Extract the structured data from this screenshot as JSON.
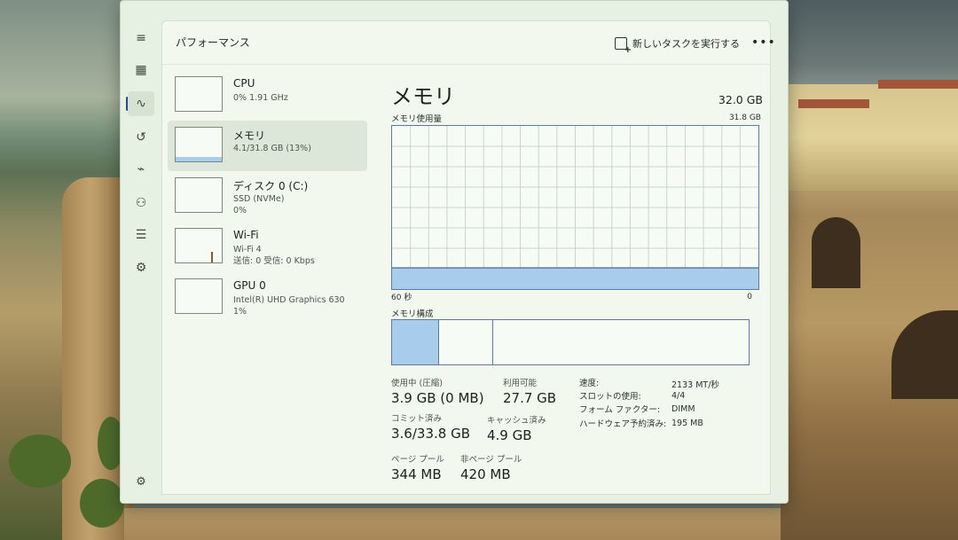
{
  "app": {
    "title": "パフォーマンス",
    "run_task_label": "新しいタスクを実行する",
    "more_label": "•••"
  },
  "nav": {
    "menu_icon": "≡",
    "items": [
      {
        "name": "processes",
        "icon": "▦"
      },
      {
        "name": "performance",
        "icon": "∿",
        "active": true
      },
      {
        "name": "app-history",
        "icon": "↺"
      },
      {
        "name": "startup",
        "icon": "⌁"
      },
      {
        "name": "users",
        "icon": "⚇"
      },
      {
        "name": "details",
        "icon": "☰"
      },
      {
        "name": "services",
        "icon": "⚙"
      }
    ],
    "settings_icon": "⚙"
  },
  "resources": [
    {
      "name": "CPU",
      "sub1": "0% 1.91 GHz",
      "sub2": "",
      "fill": 0.0
    },
    {
      "name": "メモリ",
      "sub1": "4.1/31.8 GB (13%)",
      "sub2": "",
      "fill": 0.13,
      "selected": true
    },
    {
      "name": "ディスク 0 (C:)",
      "sub1": "SSD (NVMe)",
      "sub2": "0%",
      "fill": 0.0
    },
    {
      "name": "Wi-Fi",
      "sub1": "Wi-Fi 4",
      "sub2": "送信: 0 受信: 0 Kbps",
      "fill": 0.0
    },
    {
      "name": "GPU 0",
      "sub1": "Intel(R) UHD Graphics 630",
      "sub2": "1%",
      "fill": 0.0
    }
  ],
  "detail": {
    "title": "メモリ",
    "total": "32.0 GB",
    "usage_label": "メモリ使用量",
    "usage_max": "31.8 GB",
    "axis_left": "60 秒",
    "axis_right": "0",
    "usage_fraction": 0.13,
    "composition_label": "メモリ構成",
    "composition_fractions": [
      0.13,
      0.15,
      0.72
    ],
    "stats": {
      "in_use_label": "使用中 (圧縮)",
      "in_use_value": "3.9 GB (0 MB)",
      "available_label": "利用可能",
      "available_value": "27.7 GB",
      "committed_label": "コミット済み",
      "committed_value": "3.6/33.8 GB",
      "cached_label": "キャッシュ済み",
      "cached_value": "4.9 GB",
      "paged_label": "ページ プール",
      "paged_value": "344 MB",
      "nonpaged_label": "非ページ プール",
      "nonpaged_value": "420 MB"
    },
    "specs": [
      {
        "key": "速度:",
        "value": "2133 MT/秒"
      },
      {
        "key": "スロットの使用:",
        "value": "4/4"
      },
      {
        "key": "フォーム ファクター:",
        "value": "DIMM"
      },
      {
        "key": "ハードウェア予約済み:",
        "value": "195 MB"
      }
    ]
  },
  "colors": {
    "graph_fill": "#a8ccec",
    "graph_line": "#5c7a9a",
    "grid": "#c9d4cf",
    "comp_in_use": "#a8ccec"
  }
}
